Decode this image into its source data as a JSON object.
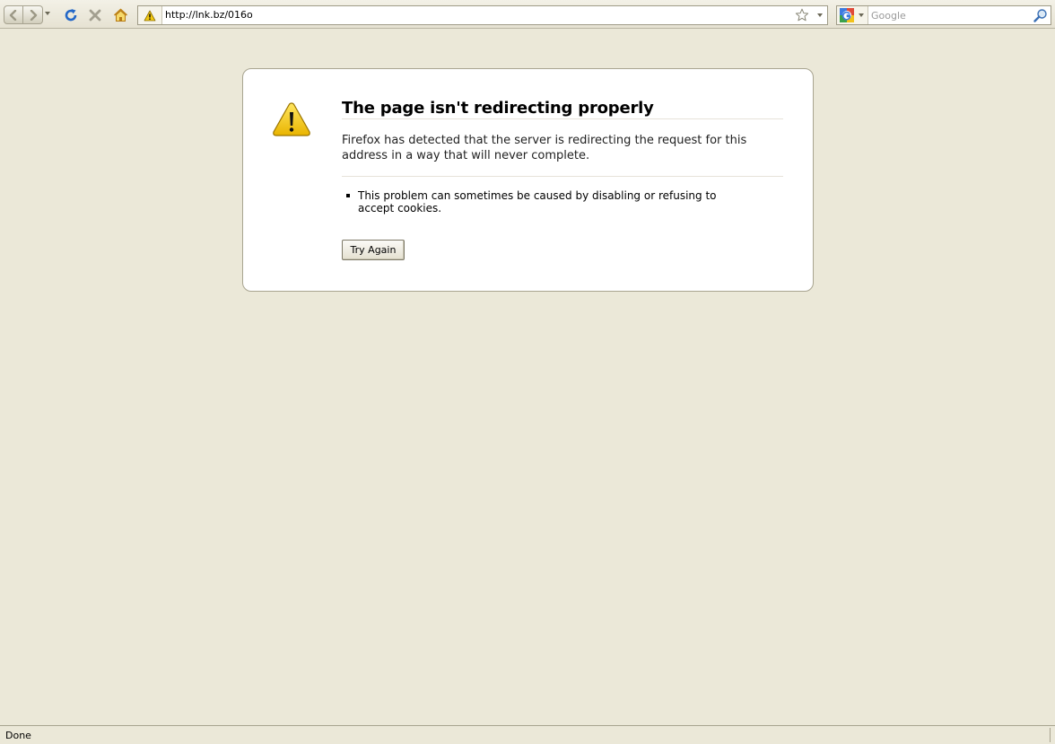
{
  "toolbar": {
    "icons": {
      "back": "back-arrow-icon",
      "forward": "forward-arrow-icon",
      "history_dropdown": "chevron-down-icon",
      "reload": "reload-icon",
      "stop": "stop-icon",
      "home": "home-icon"
    },
    "url": {
      "value": "http://lnk.bz/016o",
      "site_icon": "warning-icon",
      "bookmark_icon": "star-icon"
    },
    "search": {
      "placeholder": "Google",
      "engine_icon": "google-icon",
      "go_icon": "magnifier-icon"
    }
  },
  "error": {
    "icon": "warning-icon",
    "title": "The page isn't redirecting properly",
    "description": "Firefox has detected that the server is redirecting the request for this address in a way that will never complete.",
    "bullets": [
      "This problem can sometimes be caused by disabling or refusing to accept cookies."
    ],
    "try_again_label": "Try Again"
  },
  "statusbar": {
    "text": "Done"
  },
  "colors": {
    "page_background": "#ebe8d8",
    "reload_blue": "#2468c8",
    "warning_yellow": "#f2c810"
  }
}
